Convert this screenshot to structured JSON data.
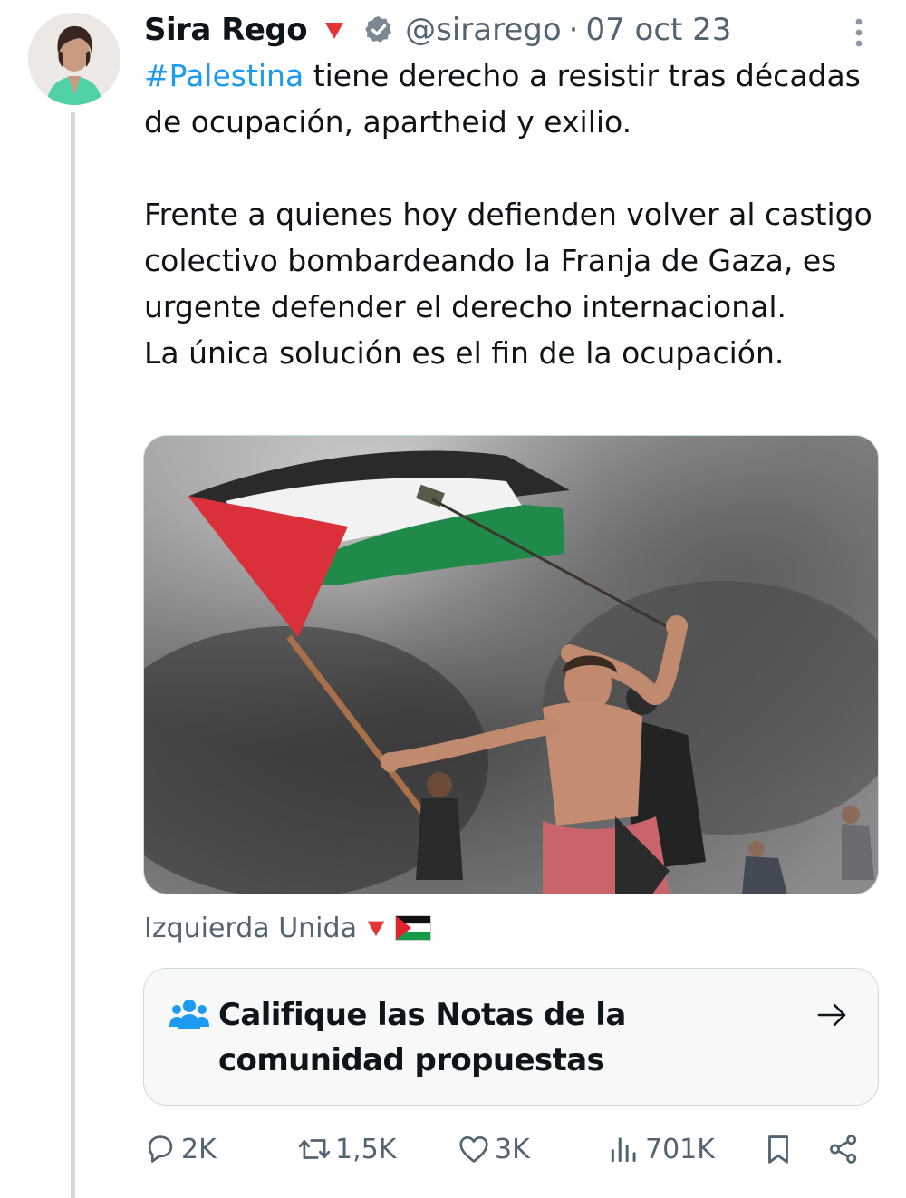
{
  "tweet": {
    "author": {
      "name": "Sira Rego",
      "handle": "@sirarego",
      "verified_icon": "verified-badge-icon",
      "party_icon": "red-triangle-icon"
    },
    "separator": "·",
    "date": "07 oct 23",
    "body": {
      "hashtag": "#Palestina",
      "text": " tiene derecho a resistir tras décadas de ocupación, apartheid y exilio.\n\nFrente a quienes hoy defienden volver al castigo colectivo bombardeando la Franja de Gaza, es urgente defender el derecho internacional.\nLa única solución es el fin de la ocupación."
    },
    "media": {
      "alt_icon": "photo-palestinian-flag-protester"
    },
    "source_label": "Izquierda Unida"
  },
  "community_notes": {
    "title": "Califique las Notas de la comunidad propuestas",
    "icon": "people-icon"
  },
  "actions": {
    "replies": "2K",
    "reposts": "1,5K",
    "likes": "3K",
    "views": "701K"
  },
  "colors": {
    "accent": "#1d9bf0",
    "secondary_text": "#536471",
    "border": "#cfd9de",
    "party_red": "#e63535"
  }
}
